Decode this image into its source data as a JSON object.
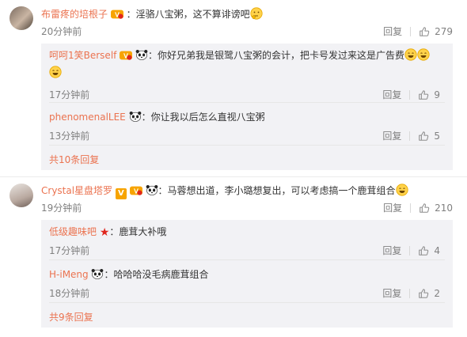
{
  "threads": [
    {
      "user": "布雷疼的培根子",
      "text": "：淫骆八宝粥，这不算诽谤吧",
      "time": "20分钟前",
      "reply": "回复",
      "likes": "279",
      "subs": [
        {
          "user": "呵呵1笑Berself",
          "text": "：你好兄弟我是银鹭八宝粥的会计，把卡号发过来这是广告费",
          "time": "17分钟前",
          "reply": "回复",
          "likes": "9"
        },
        {
          "user": "phenomenalLEE",
          "text": "：你让我以后怎么直视八宝粥",
          "time": "13分钟前",
          "reply": "回复",
          "likes": "5"
        }
      ],
      "more": "共10条回复"
    },
    {
      "user": "Crystal星盘塔罗",
      "text": "：马蓉想出道，李小璐想复出，可以考虑搞一个鹿茸组合",
      "time": "19分钟前",
      "reply": "回复",
      "likes": "210",
      "subs": [
        {
          "user": "低级趣味吧",
          "text": "：鹿茸大补哦",
          "time": "17分钟前",
          "reply": "回复",
          "likes": "4"
        },
        {
          "user": "H-iMeng",
          "text": "：哈哈哈没毛病鹿茸组合",
          "time": "18分钟前",
          "reply": "回复",
          "likes": "2"
        }
      ],
      "more": "共9条回复"
    }
  ],
  "colors": {
    "username": "#eb7350",
    "subBackground": "#f2f2f5",
    "meta": "#808080"
  },
  "icons": [
    "thumb-up-icon",
    "panda-emoji-icon",
    "laugh-emoji-icon",
    "vip-badge-icon",
    "verified-badge-icon",
    "star-badge-icon"
  ]
}
